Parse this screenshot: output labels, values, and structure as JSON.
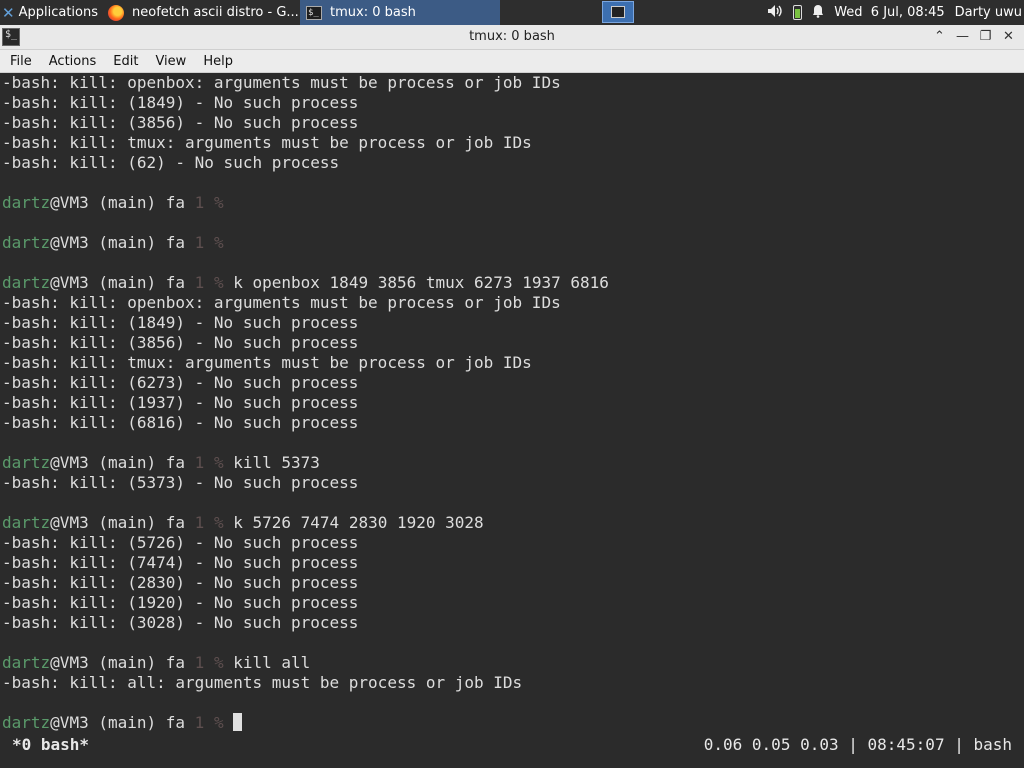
{
  "panel": {
    "applications_label": "Applications",
    "tasks": [
      {
        "label": "neofetch ascii distro - G...",
        "icon": "firefox-icon"
      },
      {
        "label": "tmux: 0 bash",
        "icon": "terminal-icon"
      }
    ],
    "clock": "Wed  6 Jul, 08:45",
    "user": "Darty uwu"
  },
  "window": {
    "title": "tmux: 0 bash",
    "controls": [
      "⌃",
      "—",
      "❐",
      "✕"
    ],
    "menu": [
      "File",
      "Actions",
      "Edit",
      "View",
      "Help"
    ]
  },
  "terminal": {
    "lines": [
      {
        "type": "out",
        "text": "-bash: kill: openbox: arguments must be process or job IDs"
      },
      {
        "type": "out",
        "text": "-bash: kill: (1849) - No such process"
      },
      {
        "type": "out",
        "text": "-bash: kill: (3856) - No such process"
      },
      {
        "type": "out",
        "text": "-bash: kill: tmux: arguments must be process or job IDs"
      },
      {
        "type": "out",
        "text": "-bash: kill: (62) - No such process"
      },
      {
        "type": "blank",
        "text": ""
      },
      {
        "type": "prompt",
        "cmd": ""
      },
      {
        "type": "blank",
        "text": ""
      },
      {
        "type": "prompt",
        "cmd": ""
      },
      {
        "type": "blank",
        "text": ""
      },
      {
        "type": "prompt",
        "cmd": "k openbox 1849 3856 tmux 6273 1937 6816"
      },
      {
        "type": "out",
        "text": "-bash: kill: openbox: arguments must be process or job IDs"
      },
      {
        "type": "out",
        "text": "-bash: kill: (1849) - No such process"
      },
      {
        "type": "out",
        "text": "-bash: kill: (3856) - No such process"
      },
      {
        "type": "out",
        "text": "-bash: kill: tmux: arguments must be process or job IDs"
      },
      {
        "type": "out",
        "text": "-bash: kill: (6273) - No such process"
      },
      {
        "type": "out",
        "text": "-bash: kill: (1937) - No such process"
      },
      {
        "type": "out",
        "text": "-bash: kill: (6816) - No such process"
      },
      {
        "type": "blank",
        "text": ""
      },
      {
        "type": "prompt",
        "cmd": "kill 5373"
      },
      {
        "type": "out",
        "text": "-bash: kill: (5373) - No such process"
      },
      {
        "type": "blank",
        "text": ""
      },
      {
        "type": "prompt",
        "cmd": "k 5726 7474 2830 1920 3028"
      },
      {
        "type": "out",
        "text": "-bash: kill: (5726) - No such process"
      },
      {
        "type": "out",
        "text": "-bash: kill: (7474) - No such process"
      },
      {
        "type": "out",
        "text": "-bash: kill: (2830) - No such process"
      },
      {
        "type": "out",
        "text": "-bash: kill: (1920) - No such process"
      },
      {
        "type": "out",
        "text": "-bash: kill: (3028) - No such process"
      },
      {
        "type": "blank",
        "text": ""
      },
      {
        "type": "prompt",
        "cmd": "kill all"
      },
      {
        "type": "out",
        "text": "-bash: kill: all: arguments must be process or job IDs"
      },
      {
        "type": "blank",
        "text": ""
      },
      {
        "type": "prompt",
        "cmd": "",
        "cursor": true
      }
    ],
    "prompt": {
      "user": "dartz",
      "host": "@VM3 (main) fa ",
      "status": "1",
      "symbol": " % "
    }
  },
  "tmux": {
    "window_label": "*0 bash*",
    "status_right": "0.06 0.05 0.03 | 08:45:07 | bash"
  },
  "colors": {
    "terminal_bg": "#2b2b2b",
    "prompt_user": "#5a9a6a",
    "prompt_dim": "#5e4f4f",
    "active_task": "#3c5b85"
  }
}
